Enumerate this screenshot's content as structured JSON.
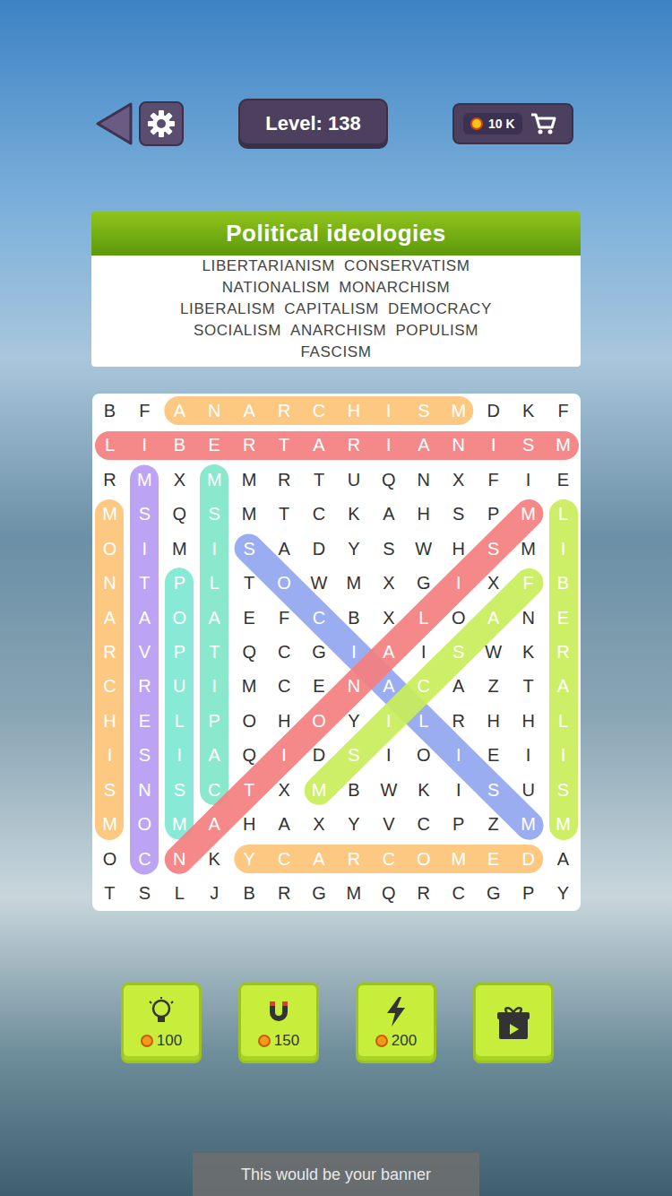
{
  "topbar": {
    "level": "Level: 138",
    "coins": "10 K"
  },
  "category": {
    "title": "Political ideologies",
    "lines": [
      [
        "LIBERTARIANISM",
        "CONSERVATISM"
      ],
      [
        "NATIONALISM",
        "MONARCHISM"
      ],
      [
        "LIBERALISM",
        "CAPITALISM",
        "DEMOCRACY"
      ],
      [
        "SOCIALISM",
        "ANARCHISM",
        "POPULISM"
      ],
      [
        "FASCISM"
      ]
    ]
  },
  "grid": {
    "rows": [
      [
        "B",
        "F",
        "A",
        "N",
        "A",
        "R",
        "C",
        "H",
        "I",
        "S",
        "M",
        "D",
        "K",
        "F"
      ],
      [
        "L",
        "I",
        "B",
        "E",
        "R",
        "T",
        "A",
        "R",
        "I",
        "A",
        "N",
        "I",
        "S",
        "M"
      ],
      [
        "R",
        "M",
        "X",
        "M",
        "M",
        "R",
        "T",
        "U",
        "Q",
        "N",
        "X",
        "F",
        "I",
        "E"
      ],
      [
        "M",
        "S",
        "Q",
        "S",
        "M",
        "T",
        "C",
        "K",
        "A",
        "H",
        "S",
        "P",
        "M",
        "L"
      ],
      [
        "O",
        "I",
        "M",
        "I",
        "S",
        "A",
        "D",
        "Y",
        "S",
        "W",
        "H",
        "S",
        "M",
        "I"
      ],
      [
        "N",
        "T",
        "P",
        "L",
        "T",
        "O",
        "W",
        "M",
        "X",
        "G",
        "I",
        "X",
        "F",
        "B"
      ],
      [
        "A",
        "A",
        "O",
        "A",
        "E",
        "F",
        "C",
        "B",
        "X",
        "L",
        "O",
        "A",
        "N",
        "E"
      ],
      [
        "R",
        "V",
        "P",
        "T",
        "Q",
        "C",
        "G",
        "I",
        "A",
        "I",
        "S",
        "W",
        "K",
        "R"
      ],
      [
        "C",
        "R",
        "U",
        "I",
        "M",
        "C",
        "E",
        "N",
        "A",
        "C",
        "A",
        "Z",
        "T",
        "A"
      ],
      [
        "H",
        "E",
        "L",
        "P",
        "O",
        "H",
        "O",
        "Y",
        "I",
        "L",
        "R",
        "H",
        "H",
        "L"
      ],
      [
        "I",
        "S",
        "I",
        "A",
        "Q",
        "I",
        "D",
        "S",
        "I",
        "O",
        "I",
        "E",
        "I",
        "I"
      ],
      [
        "S",
        "N",
        "S",
        "C",
        "T",
        "X",
        "M",
        "B",
        "W",
        "K",
        "I",
        "S",
        "U",
        "S"
      ],
      [
        "M",
        "O",
        "M",
        "A",
        "H",
        "A",
        "X",
        "Y",
        "V",
        "C",
        "P",
        "Z",
        "M",
        "M"
      ],
      [
        "O",
        "C",
        "N",
        "K",
        "Y",
        "C",
        "A",
        "R",
        "C",
        "O",
        "M",
        "E",
        "D",
        "A"
      ],
      [
        "T",
        "S",
        "L",
        "J",
        "B",
        "R",
        "G",
        "M",
        "Q",
        "R",
        "C",
        "G",
        "P",
        "Y"
      ]
    ],
    "found": [
      {
        "from": [
          0,
          2
        ],
        "to": [
          0,
          10
        ],
        "color": "#fdc477"
      },
      {
        "from": [
          1,
          0
        ],
        "to": [
          1,
          13
        ],
        "color": "#f47f7f"
      },
      {
        "from": [
          3,
          0
        ],
        "to": [
          12,
          0
        ],
        "color": "#fdc477"
      },
      {
        "from": [
          2,
          1
        ],
        "to": [
          13,
          1
        ],
        "color": "#b79bf2"
      },
      {
        "from": [
          2,
          3
        ],
        "to": [
          11,
          3
        ],
        "color": "#80e6c8"
      },
      {
        "from": [
          5,
          2
        ],
        "to": [
          12,
          2
        ],
        "color": "#7ee8d2"
      },
      {
        "from": [
          3,
          13
        ],
        "to": [
          12,
          13
        ],
        "color": "#c9ee5a"
      },
      {
        "from": [
          13,
          4
        ],
        "to": [
          13,
          12
        ],
        "color": "#fdc477"
      },
      {
        "from": [
          4,
          4
        ],
        "to": [
          12,
          12
        ],
        "color": "#92a6f0"
      },
      {
        "from": [
          3,
          12
        ],
        "to": [
          13,
          2
        ],
        "color": "#f47f7f"
      },
      {
        "from": [
          5,
          12
        ],
        "to": [
          11,
          6
        ],
        "color": "#c9ee5a"
      }
    ]
  },
  "boosters": [
    {
      "kind": "hint",
      "cost": "100"
    },
    {
      "kind": "magnet",
      "cost": "150"
    },
    {
      "kind": "bolt",
      "cost": "200"
    },
    {
      "kind": "gift"
    }
  ],
  "banner": "This would be your banner"
}
